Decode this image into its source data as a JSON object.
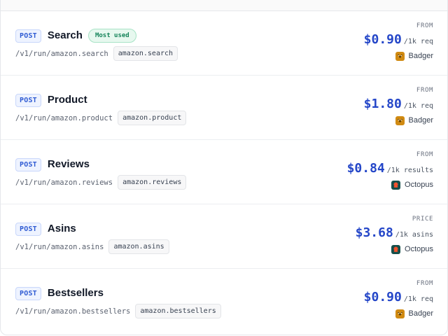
{
  "endpoints": [
    {
      "method": "POST",
      "name": "Search",
      "badge": "Most used",
      "path": "/v1/run/amazon.search",
      "code": "amazon.search",
      "price_label": "FROM",
      "price": "$0.90",
      "unit": "/1k req",
      "provider": "Badger",
      "provider_icon": "badger-icon",
      "provider_color": "#d08a12"
    },
    {
      "method": "POST",
      "name": "Product",
      "path": "/v1/run/amazon.product",
      "code": "amazon.product",
      "price_label": "FROM",
      "price": "$1.80",
      "unit": "/1k req",
      "provider": "Badger",
      "provider_icon": "badger-icon",
      "provider_color": "#d08a12"
    },
    {
      "method": "POST",
      "name": "Reviews",
      "path": "/v1/run/amazon.reviews",
      "code": "amazon.reviews",
      "price_label": "FROM",
      "price": "$0.84",
      "unit": "/1k results",
      "provider": "Octopus",
      "provider_icon": "octopus-icon",
      "provider_color": "#164e4a"
    },
    {
      "method": "POST",
      "name": "Asins",
      "path": "/v1/run/amazon.asins",
      "code": "amazon.asins",
      "price_label": "PRICE",
      "price": "$3.68",
      "unit": "/1k asins",
      "provider": "Octopus",
      "provider_icon": "octopus-icon",
      "provider_color": "#164e4a"
    },
    {
      "method": "POST",
      "name": "Bestsellers",
      "path": "/v1/run/amazon.bestsellers",
      "code": "amazon.bestsellers",
      "price_label": "FROM",
      "price": "$0.90",
      "unit": "/1k req",
      "provider": "Badger",
      "provider_icon": "badger-icon",
      "provider_color": "#d08a12"
    }
  ],
  "colors": {
    "accent_price": "#2446c8",
    "method_text": "#2f5bd3",
    "badge_green": "#16845a"
  }
}
